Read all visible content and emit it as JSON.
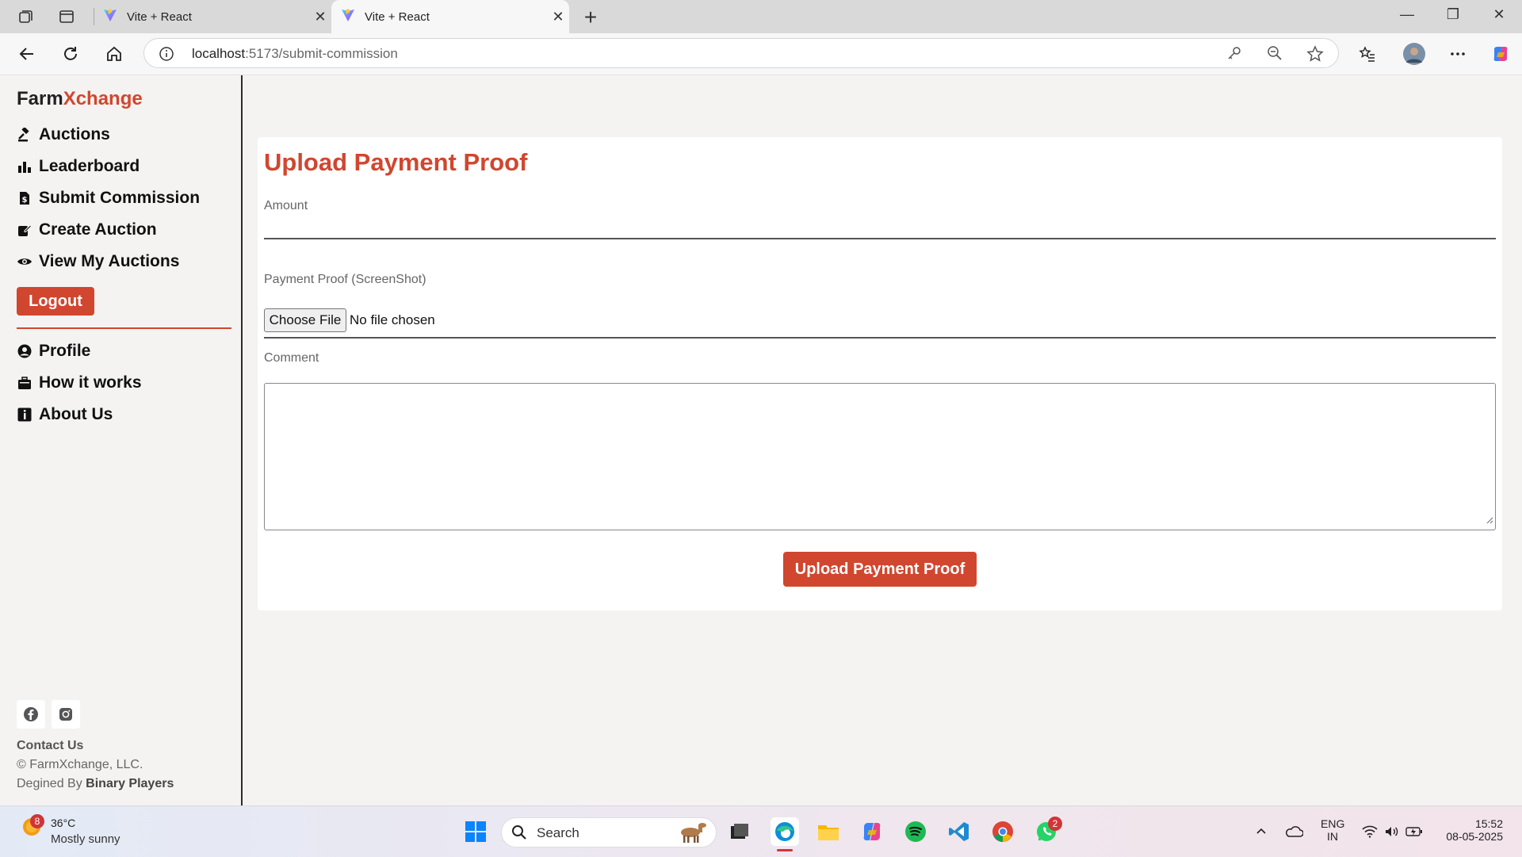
{
  "browser": {
    "tabs": [
      {
        "title": "Vite + React"
      },
      {
        "title": "Vite + React"
      }
    ],
    "url_host": "localhost",
    "url_rest": ":5173/submit-commission"
  },
  "sidebar": {
    "brand_part1": "Farm",
    "brand_part2": "Xchange",
    "nav": [
      {
        "label": "Auctions",
        "icon": "gavel-icon"
      },
      {
        "label": "Leaderboard",
        "icon": "bar-chart-icon"
      },
      {
        "label": "Submit Commission",
        "icon": "receipt-dollar-icon"
      },
      {
        "label": "Create Auction",
        "icon": "edit-icon"
      },
      {
        "label": "View My Auctions",
        "icon": "eye-icon"
      }
    ],
    "logout_label": "Logout",
    "secondary": [
      {
        "label": "Profile",
        "icon": "user-circle-icon"
      },
      {
        "label": "How it works",
        "icon": "briefcase-icon"
      },
      {
        "label": "About Us",
        "icon": "info-icon"
      }
    ],
    "contact": "Contact Us",
    "copyright": "© FarmXchange, LLC.",
    "designed_prefix": "Degined By",
    "designed_by": "Binary Players"
  },
  "form": {
    "title": "Upload Payment Proof",
    "amount_label": "Amount",
    "amount_value": "",
    "proof_label": "Payment Proof (ScreenShot)",
    "file_button": "Choose File",
    "file_status": "No file chosen",
    "comment_label": "Comment",
    "comment_value": "",
    "submit_label": "Upload Payment Proof"
  },
  "taskbar": {
    "weather_temp": "36°C",
    "weather_desc": "Mostly sunny",
    "weather_badge": "8",
    "search_placeholder": "Search",
    "whatsapp_badge": "2",
    "lang": "ENG",
    "region": "IN",
    "time": "15:52",
    "date": "08-05-2025"
  },
  "colors": {
    "accent": "#d1462f",
    "page_bg": "#f4f3f1"
  }
}
